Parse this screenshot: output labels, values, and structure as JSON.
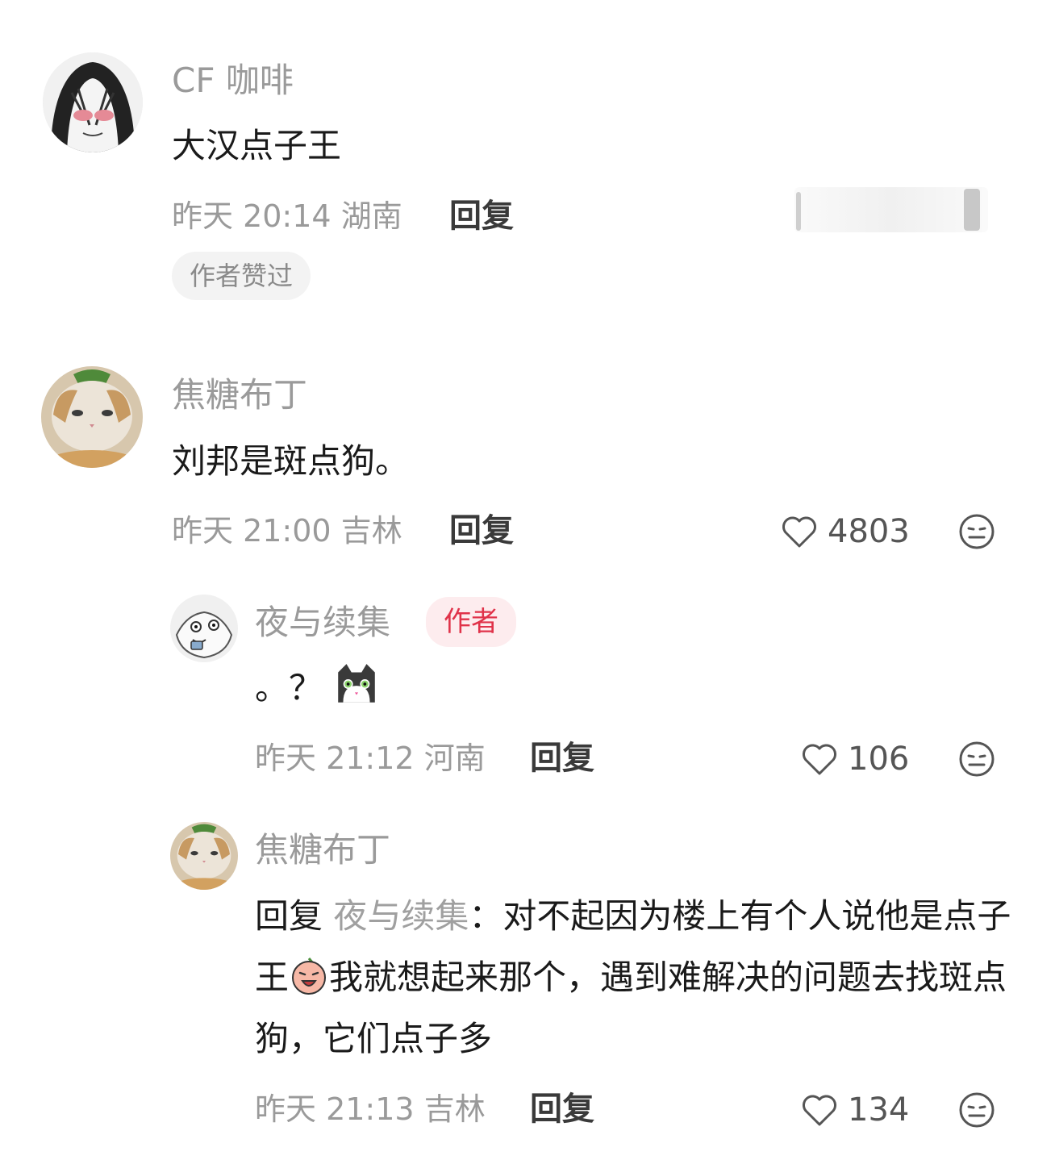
{
  "comments": [
    {
      "name": "CF 咖啡",
      "text": "大汉点子王",
      "time": "昨天 20:14",
      "region": "湖南",
      "reply_label": "回复",
      "badge": "作者赞过"
    },
    {
      "name": "焦糖布丁",
      "text": "刘邦是斑点狗。",
      "time": "昨天 21:00",
      "region": "吉林",
      "reply_label": "回复",
      "likes": "4803"
    }
  ],
  "replies": [
    {
      "name": "夜与续集",
      "author_badge": "作者",
      "text": "。？",
      "time": "昨天 21:12",
      "region": "河南",
      "reply_label": "回复",
      "likes": "106"
    },
    {
      "name": "焦糖布丁",
      "reply_prefix": "回复",
      "reply_to": "夜与续集",
      "text_part1": "：对不起因为楼上有个人说他是点子王",
      "text_part2": "我就想起来那个，遇到难解决的问题去找斑点狗，它们点子多",
      "time": "昨天 21:13",
      "region": "吉林",
      "reply_label": "回复",
      "likes": "134"
    }
  ]
}
